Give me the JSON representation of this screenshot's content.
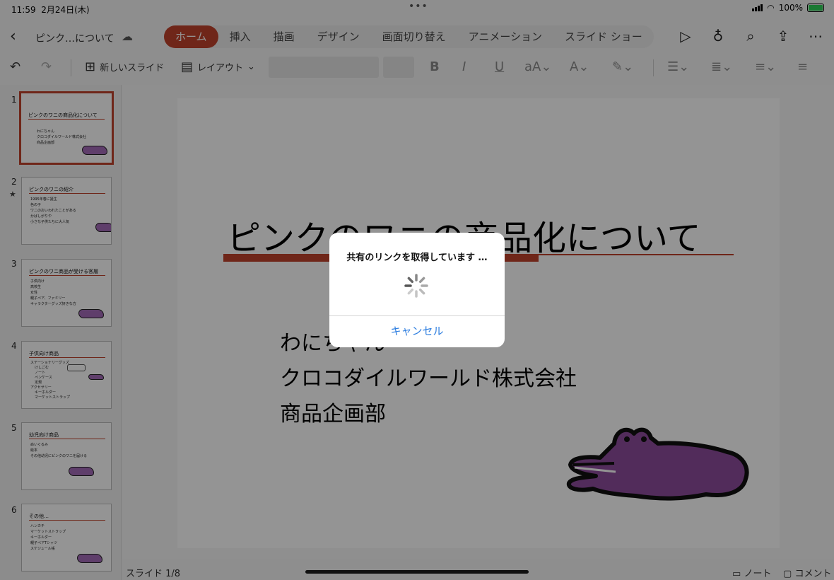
{
  "status": {
    "time": "11:59",
    "date": "2月24日(木)",
    "dots": "•••",
    "battery_pct": "100%"
  },
  "header": {
    "doc_title": "ピンク…について",
    "tabs": [
      {
        "label": "ホーム",
        "active": true
      },
      {
        "label": "挿入"
      },
      {
        "label": "描画"
      },
      {
        "label": "デザイン"
      },
      {
        "label": "画面切り替え"
      },
      {
        "label": "アニメーション"
      },
      {
        "label": "スライド ショー"
      }
    ],
    "icons": [
      "play-icon",
      "lightbulb-icon",
      "search-icon",
      "share-icon",
      "more-icon"
    ]
  },
  "ribbon": {
    "new_slide": "新しいスライド",
    "layout": "レイアウト"
  },
  "thumbnails": [
    {
      "num": "1",
      "title": "ピンクのワニの商品化について",
      "bullets": [
        "わにちゃん",
        "クロコダイルワールド株式会社",
        "商品企画部"
      ]
    },
    {
      "num": "2",
      "title": "ピンクのワニの紹介",
      "bullets": [
        "1995年春に誕生",
        "色の子",
        "ワニのおいわれたことがある",
        "かばしがりや",
        "小さな子供たちに大人気"
      ]
    },
    {
      "num": "3",
      "title": "ピンクのワニ商品が受ける客層",
      "bullets": [
        "子供向け",
        "高校生",
        "女性",
        "親子ペア、ファミリー",
        "キャラクターグッズ好きな方"
      ]
    },
    {
      "num": "4",
      "title": "子供向け商品",
      "bullets": [
        "ステーショナリーグッズ",
        "けしごむ",
        "ノート",
        "ペンケース",
        "定規",
        "アクセサリー",
        "キーホルダー",
        "マーケットストラップ"
      ]
    },
    {
      "num": "5",
      "title": "幼児向け商品",
      "bullets": [
        "ぬいぐるみ",
        "絵本",
        "その他幼児にピンクのワニを届ける"
      ]
    },
    {
      "num": "6",
      "title": "その他…",
      "bullets": [
        "ハンカチ",
        "マーケットストラップ",
        "キーホルダー",
        "親子ペアTシャツ",
        "スケジュール帳"
      ]
    }
  ],
  "slide": {
    "title": "ピンクのワニの商品化について",
    "lines": [
      "わにちゃん",
      "クロコダイルワールド株式会社",
      "商品企画部"
    ]
  },
  "footer": {
    "slide_counter": "スライド 1/8",
    "notes": "ノート",
    "comments": "コメント"
  },
  "dialog": {
    "message": "共有のリンクを取得しています …",
    "cancel": "キャンセル"
  }
}
